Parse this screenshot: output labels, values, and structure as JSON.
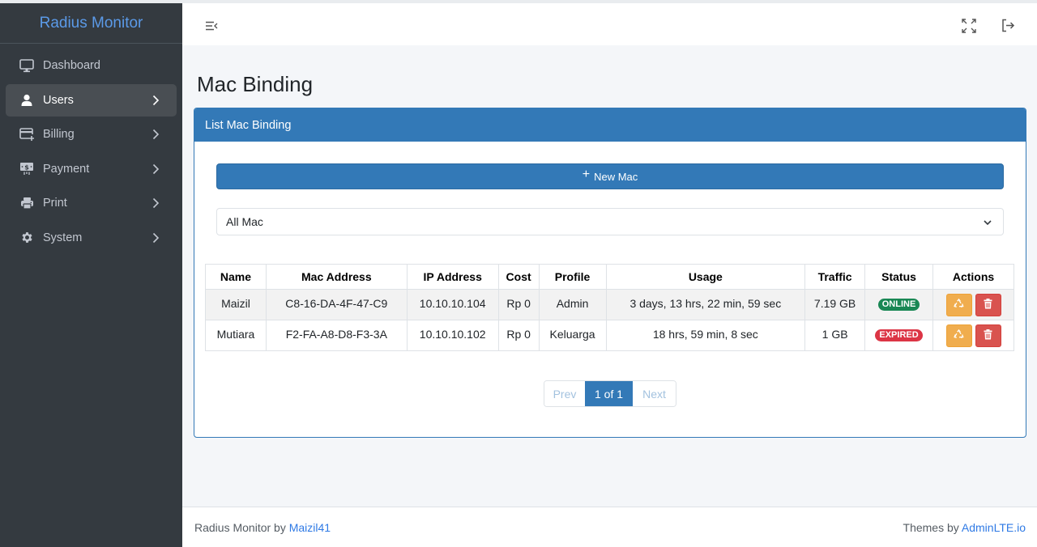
{
  "app": {
    "brand": "Radius Monitor"
  },
  "sidebar": {
    "items": [
      {
        "label": "Dashboard",
        "icon": "desktop-icon",
        "has_children": false,
        "active": false
      },
      {
        "label": "Users",
        "icon": "user-icon",
        "has_children": true,
        "active": true
      },
      {
        "label": "Billing",
        "icon": "credit-card-plus-icon",
        "has_children": true,
        "active": false
      },
      {
        "label": "Payment",
        "icon": "money-bill-icon",
        "has_children": true,
        "active": false
      },
      {
        "label": "Print",
        "icon": "printer-icon",
        "has_children": true,
        "active": false
      },
      {
        "label": "System",
        "icon": "gear-icon",
        "has_children": true,
        "active": false
      }
    ]
  },
  "header": {
    "menu_toggle_icon": "menu-collapse-icon",
    "fullscreen_icon": "fullscreen-icon",
    "logout_icon": "logout-icon"
  },
  "page": {
    "title": "Mac Binding"
  },
  "card": {
    "title": "List Mac Binding",
    "new_button_label": "New Mac",
    "filter": {
      "selected": "All Mac"
    },
    "table": {
      "columns": [
        "Name",
        "Mac Address",
        "IP Address",
        "Cost",
        "Profile",
        "Usage",
        "Traffic",
        "Status",
        "Actions"
      ],
      "rows": [
        {
          "name": "Maizil",
          "mac": "C8-16-DA-4F-47-C9",
          "ip": "10.10.10.104",
          "cost": "Rp 0",
          "profile": "Admin",
          "usage": "3 days, 13 hrs, 22 min, 59 sec",
          "traffic": "7.19 GB",
          "status": "ONLINE"
        },
        {
          "name": "Mutiara",
          "mac": "F2-FA-A8-D8-F3-3A",
          "ip": "10.10.10.102",
          "cost": "Rp 0",
          "profile": "Keluarga",
          "usage": "18 hrs, 59 min, 8 sec",
          "traffic": "1 GB",
          "status": "EXPIRED"
        }
      ]
    },
    "pagination": {
      "prev": "Prev",
      "current": "1 of 1",
      "next": "Next"
    }
  },
  "footer": {
    "left_text": "Radius Monitor by ",
    "left_link": "Maizil41",
    "right_text": "Themes by ",
    "right_link": "AdminLTE.io"
  },
  "colors": {
    "primary": "#3379b7",
    "sidebar_bg": "#343a40",
    "brand_text": "#5b9ae8",
    "online": "#198754",
    "expired": "#dc3545",
    "warning": "#f0ad4e",
    "danger": "#d9534f"
  }
}
